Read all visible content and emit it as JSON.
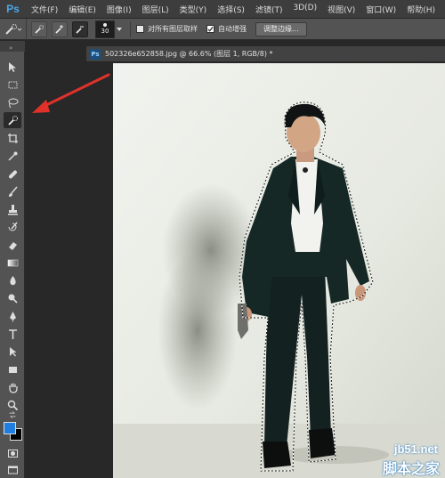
{
  "app": {
    "logo": "Ps"
  },
  "menu": {
    "items": [
      "文件(F)",
      "编辑(E)",
      "图像(I)",
      "图层(L)",
      "类型(Y)",
      "选择(S)",
      "滤镜(T)",
      "3D(D)",
      "视图(V)",
      "窗口(W)",
      "帮助(H)"
    ]
  },
  "options": {
    "brush_size": "30",
    "sample_all_layers_label": "对所有图层取样",
    "sample_all_layers_checked": false,
    "auto_enhance_label": "自动增强",
    "auto_enhance_checked": true,
    "refine_edge_label": "调整边缘..."
  },
  "document": {
    "tab_icon": "Ps",
    "tab_title": "502326e652858.jpg @ 66.6% (图层 1, RGB/8) *"
  },
  "tools": [
    "move-tool-icon",
    "rectangular-marquee-icon",
    "lasso-icon",
    "quick-selection-icon",
    "crop-icon",
    "eyedropper-icon",
    "spot-healing-icon",
    "brush-icon",
    "clone-stamp-icon",
    "history-brush-icon",
    "eraser-icon",
    "gradient-icon",
    "blur-icon",
    "dodge-icon",
    "pen-icon",
    "type-icon",
    "path-selection-icon",
    "rectangle-shape-icon",
    "hand-icon",
    "zoom-icon"
  ],
  "colors": {
    "foreground": "#1f7ee0",
    "background": "#000000",
    "annotation_arrow": "#e0312b"
  },
  "watermark": {
    "site": "jb51.net",
    "brand": "脚本之家"
  }
}
